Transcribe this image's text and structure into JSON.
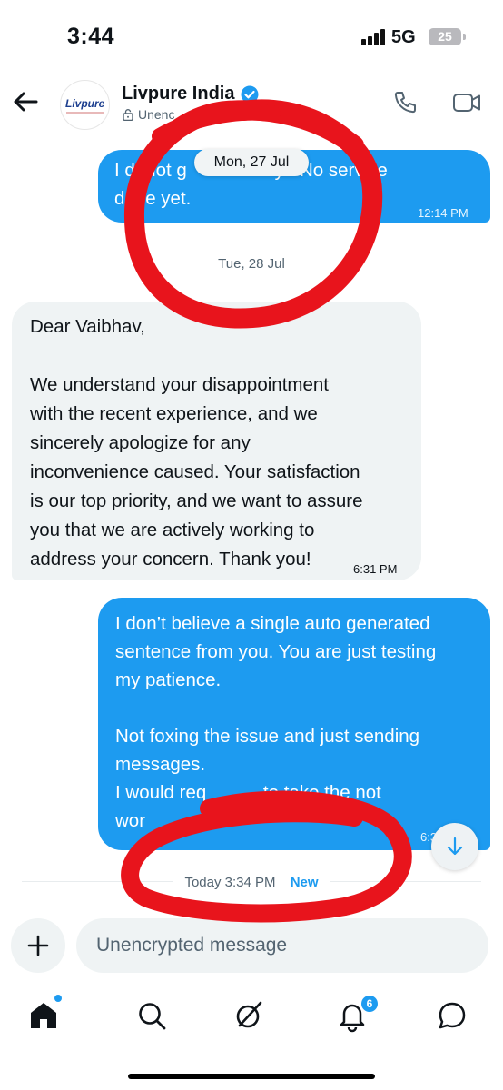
{
  "status_bar": {
    "time": "3:44",
    "network": "5G",
    "battery": "25"
  },
  "header": {
    "contact_name": "Livpure India",
    "avatar_text": "Livpure",
    "encryption_label": "Unenc"
  },
  "messages": [
    {
      "direction": "out",
      "text": "I did not get any update yet. No service\ndone yet.",
      "visible_text": "I d  not g           ate y   No service\nd  ne yet.",
      "time": "12:14 PM"
    },
    {
      "direction": "in",
      "text": "Dear Vaibhav,\n\nWe understand your disappointment\nwith the recent experience, and we\nsincerely apologize for any\ninconvenience caused. Your satisfaction\nis our top priority, and we want to assure\nyou that we are actively working to\naddress your concern. Thank you!",
      "time": "6:31 PM"
    },
    {
      "direction": "out",
      "text": "I don’t believe a single auto generated\nsentence from you. You are just testing\nmy patience.\n\nNot foxing the issue and just sending\nmessages.\nI would request you to take the not\nworking product back.",
      "visible_text": "I don’t believe a single auto generated\nsentence from you. You are just testing\nmy patience.\n\nNot foxing the issue and just sending\nmessages.\nI would req           to take the not\nwor",
      "time": "6:3"
    }
  ],
  "date_separators": {
    "floating": "Mon, 27 Jul",
    "second": "Tue, 28 Jul"
  },
  "new_marker": {
    "time": "Today 3:34 PM",
    "label": "New"
  },
  "composer": {
    "placeholder": "Unencrypted message"
  },
  "nav": {
    "notifications_badge": "6"
  },
  "colors": {
    "accent": "#1d9bf0",
    "annotation": "#e8141c",
    "incoming_bubble": "#eff3f4"
  }
}
